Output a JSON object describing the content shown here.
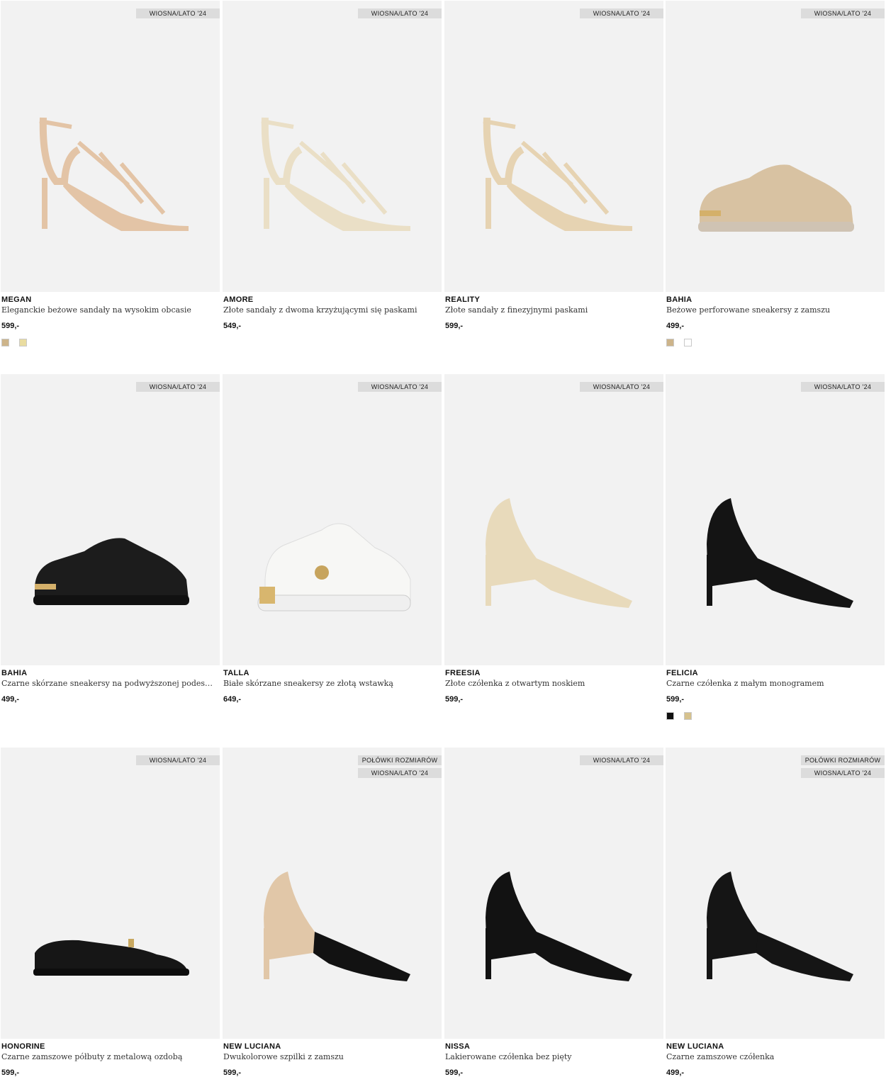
{
  "products": [
    {
      "name": "MEGAN",
      "description": "Eleganckie beżowe sandały na wysokim obcasie",
      "price": "599,-",
      "badges": [
        "WIOSNA/LATO '24"
      ],
      "swatches": [
        "#cdb48a",
        "#e9dca0"
      ],
      "shoe": "strappy-sandal",
      "color": "#e3c4a6"
    },
    {
      "name": "AMORE",
      "description": "Złote sandały z dwoma krzyżującymi się paskami",
      "price": "549,-",
      "badges": [
        "WIOSNA/LATO '24"
      ],
      "swatches": [],
      "shoe": "ankle-sandal",
      "color": "#eadfc6"
    },
    {
      "name": "REALITY",
      "description": "Złote sandały z finezyjnymi paskami",
      "price": "599,-",
      "badges": [
        "WIOSNA/LATO '24"
      ],
      "swatches": [],
      "shoe": "strappy-sandal",
      "color": "#e6d3b2"
    },
    {
      "name": "BAHIA",
      "description": "Beżowe perforowane sneakersy z zamszu",
      "price": "499,-",
      "badges": [
        "WIOSNA/LATO '24"
      ],
      "swatches": [
        "#cdb48a",
        "#ffffff"
      ],
      "shoe": "sneaker",
      "color": "#d8c2a2"
    },
    {
      "name": "BAHIA",
      "description": "Czarne skórzane sneakersy na podwyższonej podeszwie",
      "price": "499,-",
      "badges": [
        "WIOSNA/LATO '24"
      ],
      "swatches": [],
      "shoe": "sneaker",
      "color": "#1c1c1c"
    },
    {
      "name": "TALLA",
      "description": "Białe skórzane sneakersy ze złotą wstawką",
      "price": "649,-",
      "badges": [
        "WIOSNA/LATO '24"
      ],
      "swatches": [],
      "shoe": "chunky-sneaker",
      "color": "#f7f7f5"
    },
    {
      "name": "FREESIA",
      "description": "Złote czółenka z otwartym noskiem",
      "price": "599,-",
      "badges": [
        "WIOSNA/LATO '24"
      ],
      "swatches": [],
      "shoe": "peep-toe",
      "color": "#e8dabb"
    },
    {
      "name": "FELICIA",
      "description": "Czarne czółenka z małym monogramem",
      "price": "599,-",
      "badges": [
        "WIOSNA/LATO '24"
      ],
      "swatches": [
        "#111111",
        "#d6c28e"
      ],
      "shoe": "pump",
      "color": "#141414"
    },
    {
      "name": "HONORINE",
      "description": "Czarne zamszowe półbuty z metalową ozdobą",
      "price": "599,-",
      "badges": [
        "WIOSNA/LATO '24"
      ],
      "swatches": [],
      "shoe": "loafer",
      "color": "#161616"
    },
    {
      "name": "NEW LUCIANA",
      "description": "Dwukolorowe szpilki z zamszu",
      "price": "599,-",
      "badges": [
        "POŁÓWKI ROZMIARÓW",
        "WIOSNA/LATO '24"
      ],
      "swatches": [],
      "shoe": "two-tone-pump",
      "color": "#111111"
    },
    {
      "name": "NISSA",
      "description": "Lakierowane czółenka bez pięty",
      "price": "599,-",
      "badges": [
        "WIOSNA/LATO '24"
      ],
      "swatches": [],
      "shoe": "slingback",
      "color": "#121212"
    },
    {
      "name": "NEW LUCIANA",
      "description": "Czarne zamszowe czółenka",
      "price": "499,-",
      "badges": [
        "POŁÓWKI ROZMIARÓW",
        "WIOSNA/LATO '24"
      ],
      "swatches": [],
      "shoe": "pump",
      "color": "#151515"
    }
  ]
}
